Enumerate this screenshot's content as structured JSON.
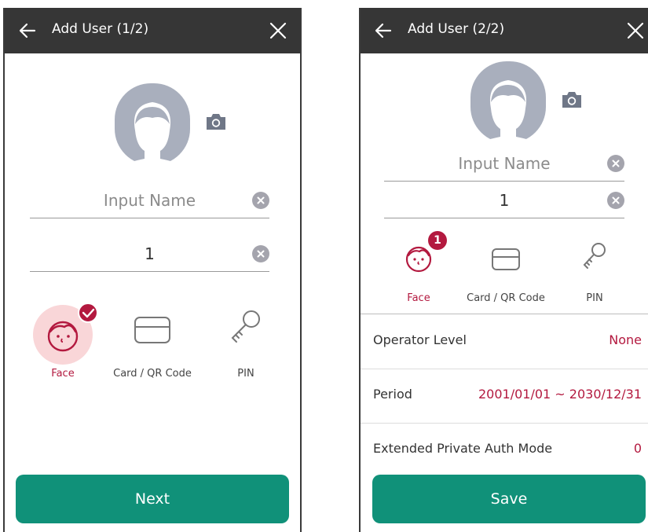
{
  "screen1": {
    "title": "Add User (1/2)",
    "name_placeholder": "Input Name",
    "id_value": "1",
    "methods": [
      {
        "label": "Face",
        "active": true
      },
      {
        "label": "Card / QR Code",
        "active": false
      },
      {
        "label": "PIN",
        "active": false
      }
    ],
    "next_label": "Next"
  },
  "screen2": {
    "title": "Add User (2/2)",
    "name_placeholder": "Input Name",
    "id_value": "1",
    "face_badge": "1",
    "methods": [
      {
        "label": "Face",
        "active": true
      },
      {
        "label": "Card / QR Code",
        "active": false
      },
      {
        "label": "PIN",
        "active": false
      }
    ],
    "settings": [
      {
        "label": "Operator Level",
        "value": "None"
      },
      {
        "label": "Period",
        "value": "2001/01/01 ~ 2030/12/31"
      },
      {
        "label": "Extended Private Auth Mode",
        "value": "0"
      }
    ],
    "save_label": "Save"
  },
  "colors": {
    "header": "#363636",
    "accent_red": "#b3193f",
    "button_green": "#109179",
    "face_bg": "#f9d6d8"
  },
  "icons": [
    "back-arrow-icon",
    "close-icon",
    "camera-icon",
    "clear-icon",
    "face-icon",
    "card-icon",
    "key-icon",
    "check-badge-icon"
  ]
}
